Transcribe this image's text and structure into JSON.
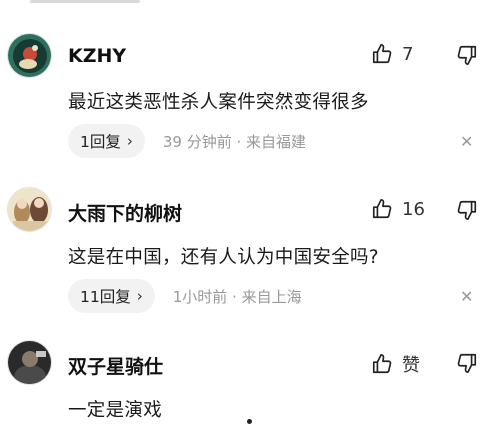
{
  "comments": [
    {
      "username": "KZHY",
      "text": "最近这类恶性杀人案件突然变得很多",
      "like_count": "7",
      "reply_label": "1回复",
      "meta": "39 分钟前 · 来自福建"
    },
    {
      "username": "大雨下的柳树",
      "text": "这是在中国，还有人认为中国安全吗?",
      "like_count": "16",
      "reply_label": "11回复",
      "meta": "1小时前 · 来自上海"
    },
    {
      "username": "双子星骑仕",
      "text": "一定是演戏",
      "like_count": "赞"
    }
  ],
  "icons": {
    "like": "thumbs-up-icon",
    "dislike": "thumbs-down-icon",
    "close": "close-icon",
    "chevron": "chevron-right-icon"
  },
  "colors": {
    "meta_text": "#999999",
    "pill_bg": "#f2f2f2"
  }
}
